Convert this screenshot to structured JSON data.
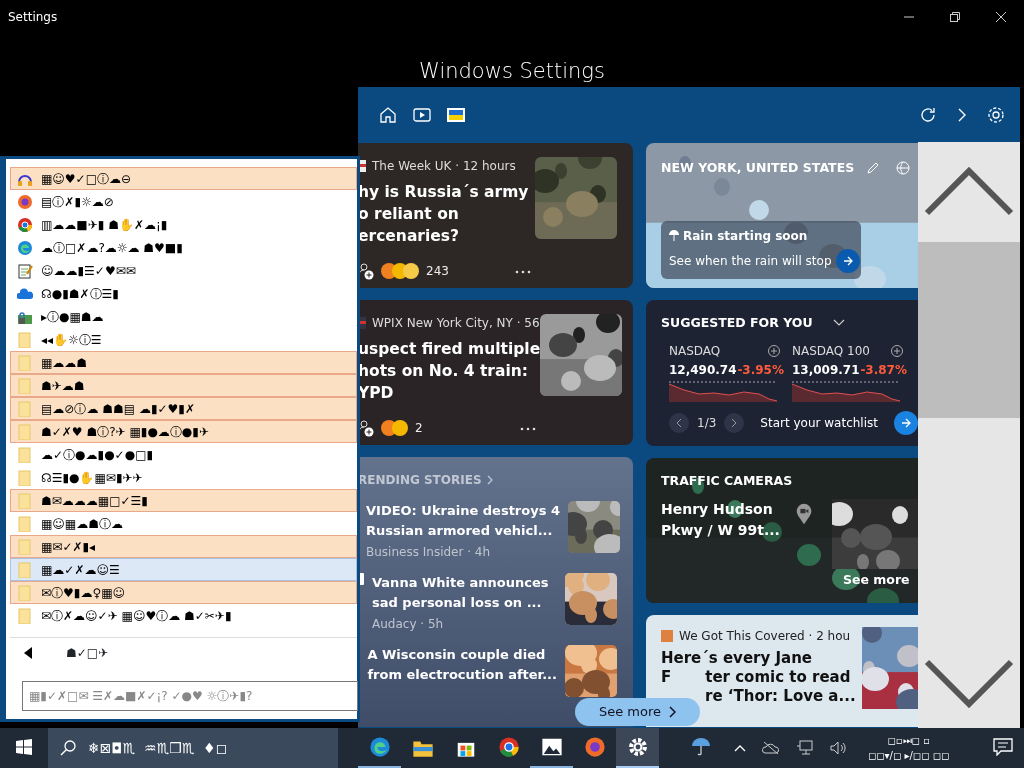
{
  "title_bar": {
    "title": "Settings"
  },
  "settings_heading": "Windows Settings",
  "widgets": {
    "news_cards": [
      {
        "source": "The Week UK · 12 hours",
        "headline_lines": [
          "hy is Russia´s army",
          "o reliant on",
          "ercenaries?"
        ],
        "reaction_count": "243"
      },
      {
        "source": "WPIX New York City, NY · 56",
        "headline_lines": [
          "uspect fired multiple",
          "hots on No. 4 train:",
          "YPD"
        ],
        "reaction_count": "2"
      }
    ],
    "trending": {
      "title": "RENDING STORIES",
      "stories": [
        {
          "headline_lines": [
            "VIDEO: Ukraine destroys 4",
            "Russian armored vehicl..."
          ],
          "source": "Business Insider · 4h"
        },
        {
          "headline_lines": [
            "Vanna White announces",
            "sad personal loss on ..."
          ],
          "source": "Audacy · 5h"
        },
        {
          "headline_lines": [
            "A Wisconsin couple died",
            "from electrocution after..."
          ]
        }
      ]
    },
    "weather": {
      "location": "NEW YORK, UNITED STATES",
      "alert_title": "Rain starting soon",
      "alert_text": "See when the rain will stop"
    },
    "stocks": {
      "title": "SUGGESTED FOR YOU",
      "items": [
        {
          "name": "NASDAQ",
          "value": "12,490.74",
          "change": "-3.95%"
        },
        {
          "name": "NASDAQ 100",
          "value": "13,009.71",
          "change": "-3.87%"
        }
      ],
      "page": "1/3",
      "watchlist": "Start your watchlist"
    },
    "traffic": {
      "title": "TRAFFIC CAMERAS",
      "camera_lines": [
        "Henry Hudson",
        "Pkwy / W 99t..."
      ],
      "see_more": "See more"
    },
    "article": {
      "source": "We Got This Covered · 2 hou",
      "headline_lines": [
        "Here´s every Jane",
        "F",
        "ter comic to read",
        "re ‘Thor: Love a..."
      ]
    },
    "see_more": "See more"
  },
  "launcher": {
    "items": [
      {
        "kind": "audio",
        "label": "▦☺♥✓□ⓘ☁⊖",
        "highlighted": true,
        "selected": false
      },
      {
        "kind": "firefox",
        "label": "▤ⓘ✗▮☼☁⊘",
        "highlighted": false,
        "selected": false
      },
      {
        "kind": "chrome",
        "label": "▥☁☁■✈▮ ☗✋✗☁¡▮",
        "highlighted": false,
        "selected": false
      },
      {
        "kind": "edge",
        "label": "☁ⓘ□✗☁?☁☼☁ ☗♥■▮",
        "highlighted": false,
        "selected": false
      },
      {
        "kind": "notepad",
        "label": "☺☁☁▮☰✓♥✉✉",
        "highlighted": false,
        "selected": false
      },
      {
        "kind": "onedrive",
        "label": "☊●▮☗✗ⓘ☰▮",
        "highlighted": false,
        "selected": false
      },
      {
        "kind": "lockapp",
        "label": "▸ⓘ●▦☗☁",
        "highlighted": false,
        "selected": false
      },
      {
        "kind": "folder",
        "label": "◂◂✋☼ⓘ☰",
        "highlighted": false,
        "selected": false
      },
      {
        "kind": "folder",
        "label": "▦☁☁☗",
        "highlighted": true,
        "selected": false
      },
      {
        "kind": "folder",
        "label": "☗✈☁☗",
        "highlighted": true,
        "selected": false
      },
      {
        "kind": "folder",
        "label": "▤☁⊘ⓘ☁ ☗☗▤ ☁▮✓♥▮✗",
        "highlighted": true,
        "selected": false
      },
      {
        "kind": "folder",
        "label": "☗✓✗♥ ☗ⓘ?✈ ▦▮●☁ⓘ●▮✈",
        "highlighted": true,
        "selected": false
      },
      {
        "kind": "folder",
        "label": "☁✓ⓘ●☁▮●✓●□▮",
        "highlighted": false,
        "selected": false
      },
      {
        "kind": "folder",
        "label": "☊☰▮●✋▦✉▮✈✈",
        "highlighted": false,
        "selected": false
      },
      {
        "kind": "folder",
        "label": "☗✉☁☁☁▦□✓☰▮",
        "highlighted": true,
        "selected": false
      },
      {
        "kind": "folder",
        "label": "▦☺▦☁☗ⓘ☁",
        "highlighted": false,
        "selected": false
      },
      {
        "kind": "folder",
        "label": "▦✉✓✗▮◂",
        "highlighted": true,
        "selected": false
      },
      {
        "kind": "folder",
        "label": "▦☁✓✗☁☺☰",
        "highlighted": false,
        "selected": true
      },
      {
        "kind": "folder",
        "label": "✉ⓘ♥▮☁♀▦☺",
        "highlighted": true,
        "selected": false
      },
      {
        "kind": "folder",
        "label": "✉ⓘ✗☁☺✓✈ ▦☺♥ⓘ☁ ☗✓✂✈▮",
        "highlighted": false,
        "selected": false
      }
    ],
    "back_label": "☗✓□✈",
    "search_placeholder": "▦▮✓✗□✉ ☰✗☁■✗✓¡? ✓●♥ ☼ⓘ✈▮?"
  },
  "taskbar": {
    "search_placeholder": "❄⊠◘♏  ♒♏❒♏  ♦◻",
    "apps": [
      {
        "kind": "edge",
        "running": true,
        "selected": false
      },
      {
        "kind": "explorer",
        "running": false,
        "selected": false
      },
      {
        "kind": "store",
        "running": false,
        "selected": false
      },
      {
        "kind": "chrome",
        "running": false,
        "selected": false
      },
      {
        "kind": "photos",
        "running": true,
        "selected": false
      },
      {
        "kind": "firefox",
        "running": false,
        "selected": false
      },
      {
        "kind": "settings",
        "running": true,
        "selected": true
      }
    ],
    "clock_lines": [
      "◻▫⏭◻ ▫",
      "◻◻▾/◻ ▸/◻◻ ◻◻"
    ]
  }
}
